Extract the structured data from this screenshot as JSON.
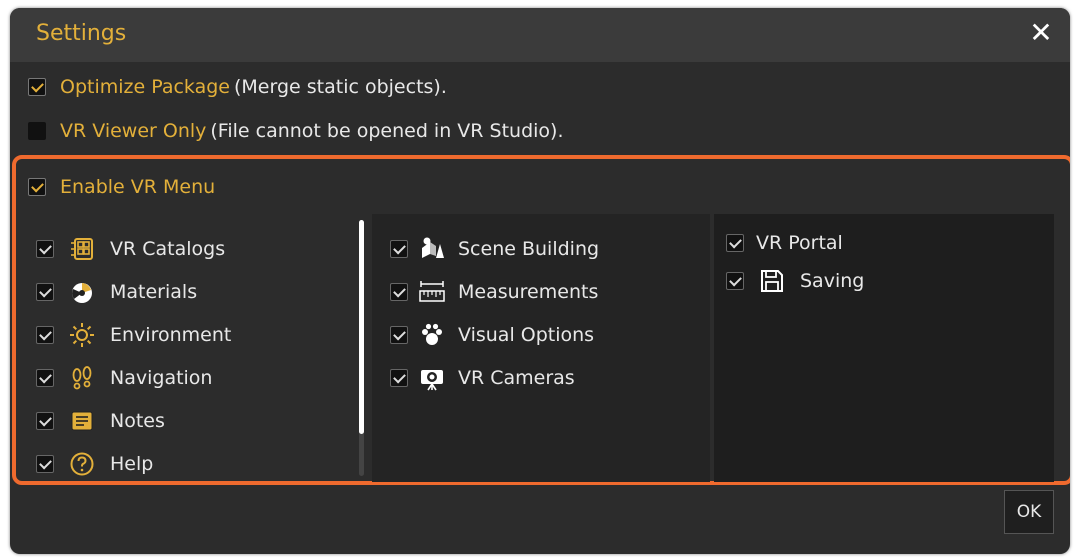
{
  "dialog": {
    "title": "Settings",
    "close_label": "✕",
    "ok_label": "OK"
  },
  "options": [
    {
      "label": "Optimize Package",
      "note": "(Merge static objects).",
      "checked": true
    },
    {
      "label": "VR Viewer Only",
      "note": "(File cannot be opened in VR Studio).",
      "checked": false
    }
  ],
  "vr_menu": {
    "label": "Enable VR Menu",
    "checked": true,
    "column1": [
      {
        "label": "VR Catalogs",
        "icon": "catalog-grid-icon",
        "checked": true
      },
      {
        "label": "Materials",
        "icon": "materials-sphere-icon",
        "checked": true
      },
      {
        "label": "Environment",
        "icon": "sun-icon",
        "checked": true
      },
      {
        "label": "Navigation",
        "icon": "footprints-icon",
        "checked": true
      },
      {
        "label": "Notes",
        "icon": "notes-icon",
        "checked": true
      },
      {
        "label": "Help",
        "icon": "help-icon",
        "checked": true
      }
    ],
    "column2": [
      {
        "label": "Scene Building",
        "icon": "shapes-icon",
        "checked": true
      },
      {
        "label": "Measurements",
        "icon": "ruler-icon",
        "checked": true
      },
      {
        "label": "Visual Options",
        "icon": "paw-icon",
        "checked": true
      },
      {
        "label": "VR Cameras",
        "icon": "camera-icon",
        "checked": true
      }
    ],
    "column3": [
      {
        "label": "VR Portal",
        "icon": "",
        "checked": true
      },
      {
        "label": "Saving",
        "icon": "save-icon",
        "checked": true
      }
    ]
  },
  "colors": {
    "accent": "#e3b03a",
    "highlight_frame": "#ef6a2e",
    "background": "#2c2c2c"
  }
}
